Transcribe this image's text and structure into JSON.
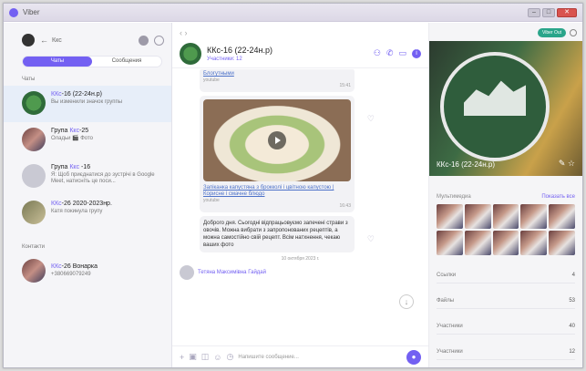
{
  "window": {
    "title": "Viber"
  },
  "sidebar": {
    "search_query": "Ккс",
    "segments": [
      "Чаты",
      "Сообщения"
    ],
    "chats_label": "Чаты",
    "chats": [
      {
        "title_prefix": "",
        "title_hl": "ККс",
        "title_rest": "-16 (22-24н.р)",
        "time": "",
        "subtitle": "Вы изменили значок группы"
      },
      {
        "title_prefix": "Група ",
        "title_hl": "Ккс",
        "title_rest": "-25",
        "time": "",
        "subtitle": "Оладьи 🎬 Фото"
      },
      {
        "title_prefix": "Група ",
        "title_hl": "Ккс",
        "title_rest": " -16",
        "time": "",
        "subtitle": "Я: Щоб приєднатися до зустрічі в Google Meet, натисніть це поси..."
      },
      {
        "title_prefix": "",
        "title_hl": "ККс",
        "title_rest": "-26 2020-2023нр.",
        "time": "",
        "subtitle": "Катя покинула групу"
      }
    ],
    "contacts_label": "Контакти",
    "contacts": [
      {
        "name_hl": "ККс",
        "name_rest": "-26 Вонарка",
        "phone": "+380669079249"
      }
    ]
  },
  "chat": {
    "title": "ККс-16 (22-24н.р)",
    "participants": "Участники: 12",
    "messages": {
      "m1_link": "Блогутными",
      "m1_meta": "youtube",
      "m1_time": "15:41",
      "m2_link": "Запіканка капустяна з брокколі і цвітною капустою | Корисне і смачне блюдо",
      "m2_meta": "youtube",
      "m2_time": "16:43",
      "m3_text": "Доброго дня. Сьогодні відпрацьовуємо запечені страви з овочів. Можна вибрати з запропонованих рецептів, а можна самостійно свій рецепт. Всім натхнення, чекаю ваших фото",
      "date_sep": "10 октября 2023 г.",
      "m4_author": "Тетяна Максимівна Гайдай"
    },
    "composer_placeholder": "Напишите сообщение..."
  },
  "info": {
    "viber_out": "Viber Out",
    "group_name": "ККс-16 (22-24н.р)",
    "media_label": "Мультимедиа",
    "show_all": "Показать все",
    "stats": [
      {
        "label": "Ссылки",
        "value": "4"
      },
      {
        "label": "Файлы",
        "value": "53"
      },
      {
        "label": "Участники",
        "value": "40"
      },
      {
        "label": "Участники",
        "value": "12"
      }
    ]
  }
}
